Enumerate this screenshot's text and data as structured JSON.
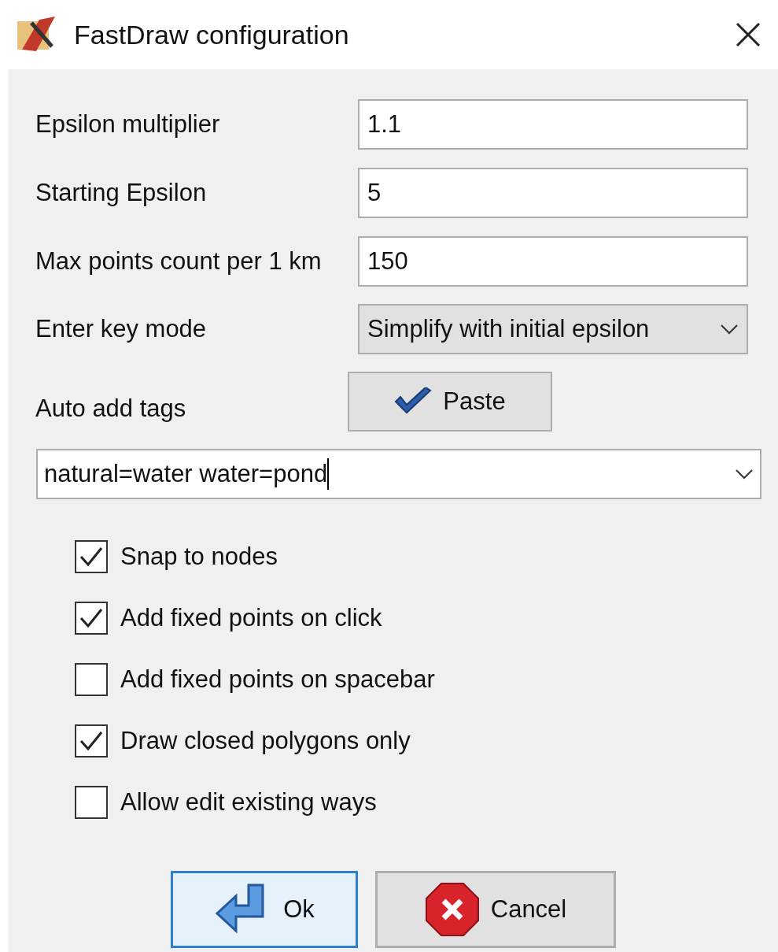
{
  "window": {
    "title": "FastDraw configuration"
  },
  "fields": [
    {
      "label": "Epsilon multiplier",
      "value": "1.1"
    },
    {
      "label": "Starting Epsilon",
      "value": "5"
    },
    {
      "label": "Max points count per 1 km",
      "value": "150"
    }
  ],
  "enter_key_mode": {
    "label": "Enter key mode",
    "value": "Simplify with initial epsilon"
  },
  "auto_add_tags": {
    "label": "Auto add tags",
    "paste_button": "Paste",
    "value": "natural=water water=pond"
  },
  "options": [
    {
      "label": "Snap to nodes",
      "checked": true
    },
    {
      "label": "Add fixed points on click",
      "checked": true
    },
    {
      "label": "Add fixed points on spacebar",
      "checked": false
    },
    {
      "label": "Draw closed polygons only",
      "checked": true
    },
    {
      "label": "Allow edit existing ways",
      "checked": false
    }
  ],
  "buttons": [
    {
      "kind": "ok",
      "label": "Ok",
      "selected": true
    },
    {
      "kind": "cancel",
      "label": "Cancel",
      "selected": false
    }
  ]
}
